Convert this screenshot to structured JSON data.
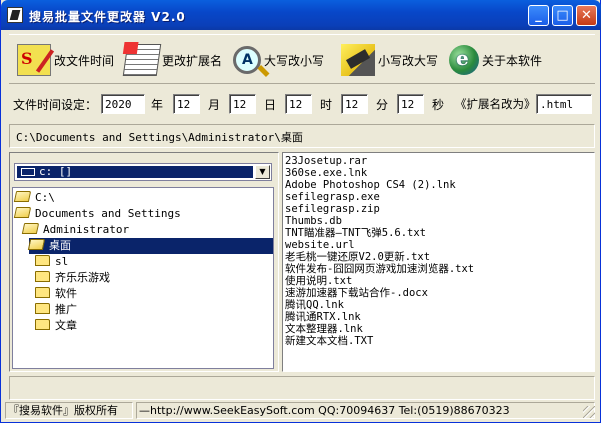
{
  "window": {
    "title": "搜易批量文件更改器 V2.0",
    "controls": [
      "_",
      "□",
      "✕"
    ]
  },
  "toolbar": {
    "items": [
      {
        "label": "改文件时间",
        "icon": "file-time-icon"
      },
      {
        "label": "更改扩展名",
        "icon": "extension-files-icon"
      },
      {
        "label": "大写改小写",
        "icon": "magnifier-case-icon"
      },
      {
        "label": "小写改大写",
        "icon": "pencil-case-icon"
      },
      {
        "label": "关于本软件",
        "icon": "about-globe-icon"
      }
    ]
  },
  "settings": {
    "time_label": "文件时间设定：",
    "year": "2020",
    "year_unit": "年",
    "month": "12",
    "month_unit": "月",
    "day": "12",
    "day_unit": "日",
    "hour": "12",
    "hour_unit": "时",
    "minute": "12",
    "minute_unit": "分",
    "second": "12",
    "second_unit": "秒",
    "ext_label": "《扩展名改为》",
    "ext_value": ".html"
  },
  "path": "C:\\Documents and Settings\\Administrator\\桌面",
  "drive": {
    "selected": "c: []"
  },
  "tree": [
    {
      "label": "C:\\",
      "open": true
    },
    {
      "label": "Documents and Settings",
      "open": true
    },
    {
      "label": "Administrator",
      "open": true
    },
    {
      "label": "桌面",
      "open": true,
      "selected": true
    },
    {
      "label": "sl",
      "open": false
    },
    {
      "label": "齐乐乐游戏",
      "open": false
    },
    {
      "label": "软件",
      "open": false
    },
    {
      "label": "推广",
      "open": false
    },
    {
      "label": "文章",
      "open": false
    }
  ],
  "files": [
    "23Josetup.rar",
    "360se.exe.lnk",
    "Adobe Photoshop CS4 (2).lnk",
    "sefilegrasp.exe",
    "sefilegrasp.zip",
    "Thumbs.db",
    "TNT瞄准器—TNT飞弹5.6.txt",
    "website.url",
    "老毛桃一键还原V2.0更新.txt",
    "软件发布-囧囧网页游戏加速浏览器.txt",
    "使用说明.txt",
    "速游加速器下载站合作-.docx",
    "腾讯QQ.lnk",
    "腾讯通RTX.lnk",
    "文本整理器.lnk",
    "新建文本文档.TXT"
  ],
  "status": {
    "copyright": "『搜易软件』版权所有",
    "contact": "—http://www.SeekEasySoft.com QQ:70094637 Tel:(0519)88670323"
  }
}
